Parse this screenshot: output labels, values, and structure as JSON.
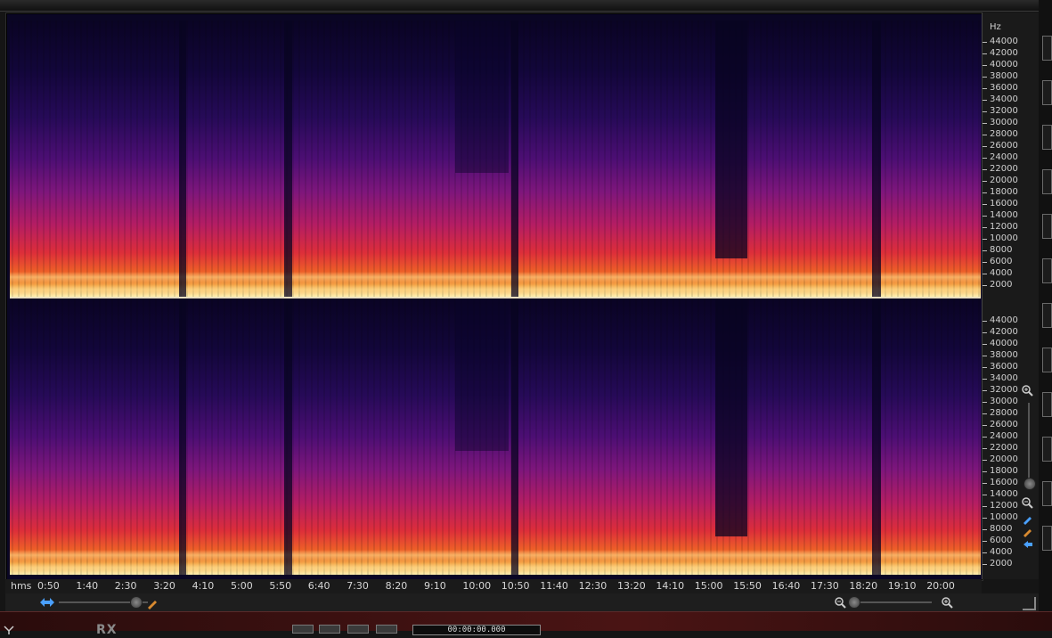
{
  "spectrogram": {
    "colormap": [
      "#0a0424",
      "#260a58",
      "#7e167c",
      "#dd2e3a",
      "#f4a848",
      "#fff2b0"
    ]
  },
  "freq_axis": {
    "unit": "Hz",
    "top_channel_labels": [
      "44000",
      "42000",
      "40000",
      "38000",
      "36000",
      "34000",
      "32000",
      "30000",
      "28000",
      "26000",
      "24000",
      "22000",
      "20000",
      "18000",
      "16000",
      "14000",
      "12000",
      "10000",
      "8000",
      "6000",
      "4000",
      "2000"
    ],
    "bottom_channel_labels": [
      "44000",
      "42000",
      "40000",
      "38000",
      "36000",
      "34000",
      "32000",
      "30000",
      "28000",
      "26000",
      "24000",
      "22000",
      "20000",
      "18000",
      "16000",
      "14000",
      "12000",
      "10000",
      "8000",
      "6000",
      "4000",
      "2000"
    ]
  },
  "time_axis": {
    "unit": "hms",
    "ticks": [
      "0:50",
      "1:40",
      "2:30",
      "3:20",
      "4:10",
      "5:00",
      "5:50",
      "6:40",
      "7:30",
      "8:20",
      "9:10",
      "10:00",
      "10:50",
      "11:40",
      "12:30",
      "13:20",
      "14:10",
      "15:00",
      "15:50",
      "16:40",
      "17:30",
      "18:20",
      "19:10",
      "20:00"
    ]
  },
  "status_bar": {
    "logo": "RX",
    "time_readout": "00:00:00.000"
  },
  "icons": {
    "scroll_left": "horizontal-scroll-icon",
    "zoom_out": "zoom-out-icon",
    "zoom_in": "zoom-in-icon"
  }
}
